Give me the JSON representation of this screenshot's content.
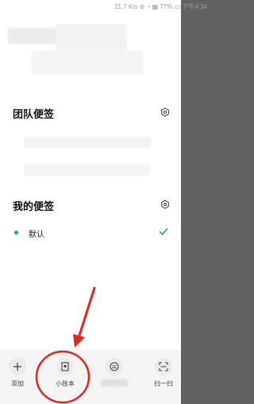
{
  "status_bar": {
    "text": "21.7 K/s ⊚ ◔ ▦ 77% ▭ 下午4:34"
  },
  "sections": [
    {
      "title": "团队便签"
    },
    {
      "title": "我的便签"
    }
  ],
  "my_notes": [
    {
      "label": "默认",
      "selected": true
    }
  ],
  "toolbar": [
    {
      "label": "添加",
      "icon": "plus-icon"
    },
    {
      "label": "小账本",
      "icon": "ledger-icon"
    },
    {
      "label": "",
      "icon": "list-circle-icon"
    },
    {
      "label": "扫一扫",
      "icon": "scan-icon"
    }
  ],
  "colors": {
    "accent": "#19a88a",
    "annotation": "#e8241d"
  }
}
